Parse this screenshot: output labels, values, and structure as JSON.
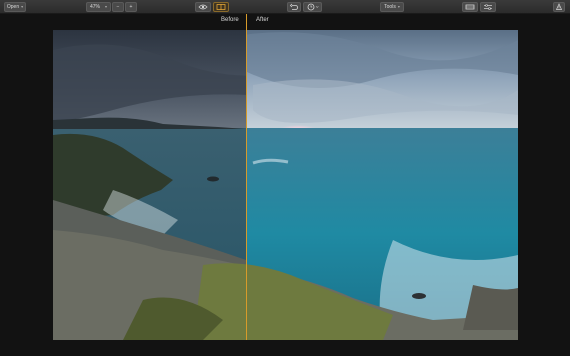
{
  "toolbar": {
    "open_label": "Open",
    "zoom_value": "47%",
    "zoom_out_symbol": "−",
    "zoom_in_symbol": "+",
    "tools_label": "Tools",
    "accent_color": "#d79b2a"
  },
  "compare": {
    "before_label": "Before",
    "after_label": "After"
  },
  "icons": {
    "preview": "eye-icon",
    "split_view": "split-view-icon",
    "undo": "undo-icon",
    "history": "history-icon",
    "presets": "presets-icon",
    "adjustments": "adjustments-icon",
    "share": "share-icon"
  }
}
